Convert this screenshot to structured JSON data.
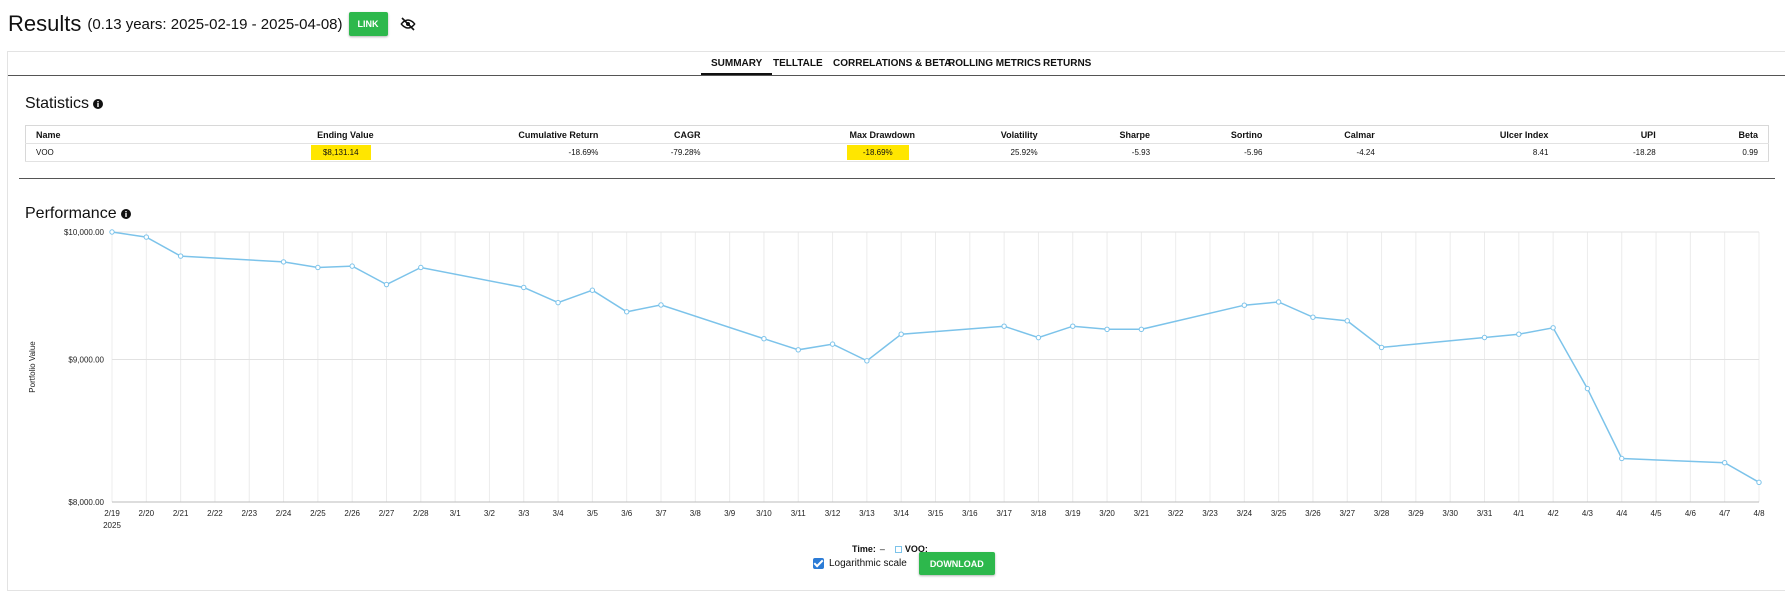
{
  "header": {
    "title": "Results",
    "range": "(0.13 years: 2025-02-19 - 2025-04-08)",
    "link_label": "LINK"
  },
  "tabs": [
    {
      "label": "SUMMARY",
      "active": true
    },
    {
      "label": "TELLTALE",
      "active": false
    },
    {
      "label": "CORRELATIONS & BETA",
      "active": false
    },
    {
      "label": "ROLLING METRICS",
      "active": false
    },
    {
      "label": "RETURNS",
      "active": false
    }
  ],
  "statistics": {
    "title": "Statistics",
    "columns": [
      "Name",
      "Ending Value",
      "Cumulative Return",
      "CAGR",
      "Max Drawdown",
      "Volatility",
      "Sharpe",
      "Sortino",
      "Calmar",
      "Ulcer Index",
      "UPI",
      "Beta"
    ],
    "rows": [
      [
        "VOO",
        "$8,131.14",
        "-18.69%",
        "-79.28%",
        "-18.69%",
        "25.92%",
        "-5.93",
        "-5.96",
        "-4.24",
        "8.41",
        "-18.28",
        "0.99"
      ]
    ],
    "highlight_color": "#ffe600"
  },
  "performance": {
    "title": "Performance"
  },
  "chart_data": {
    "type": "line",
    "ylabel": "Portfolio Value",
    "log_scale": true,
    "grid": true,
    "y_ticks": [
      "$10,000.00",
      "$9,000.00",
      "$8,000.00"
    ],
    "y_tick_values": [
      10000,
      9000,
      8000
    ],
    "x_year_label": "2025",
    "categories": [
      "2/19",
      "2/20",
      "2/21",
      "2/22",
      "2/23",
      "2/24",
      "2/25",
      "2/26",
      "2/27",
      "2/28",
      "3/1",
      "3/2",
      "3/3",
      "3/4",
      "3/5",
      "3/6",
      "3/7",
      "3/8",
      "3/9",
      "3/10",
      "3/11",
      "3/12",
      "3/13",
      "3/14",
      "3/15",
      "3/16",
      "3/17",
      "3/18",
      "3/19",
      "3/20",
      "3/21",
      "3/22",
      "3/23",
      "3/24",
      "3/25",
      "3/26",
      "3/27",
      "3/28",
      "3/29",
      "3/30",
      "3/31",
      "4/1",
      "4/2",
      "4/3",
      "4/4",
      "4/5",
      "4/6",
      "4/7",
      "4/8"
    ],
    "series": [
      {
        "name": "VOO",
        "color": "#7cc3ea",
        "points": [
          [
            "2/19",
            10000
          ],
          [
            "2/20",
            9958
          ],
          [
            "2/21",
            9803
          ],
          [
            "2/24",
            9756
          ],
          [
            "2/25",
            9711
          ],
          [
            "2/26",
            9722
          ],
          [
            "2/27",
            9575
          ],
          [
            "2/28",
            9711
          ],
          [
            "3/3",
            9552
          ],
          [
            "3/4",
            9433
          ],
          [
            "3/5",
            9530
          ],
          [
            "3/6",
            9362
          ],
          [
            "3/7",
            9415
          ],
          [
            "3/10",
            9156
          ],
          [
            "3/11",
            9072
          ],
          [
            "3/12",
            9115
          ],
          [
            "3/13",
            8990
          ],
          [
            "3/14",
            9190
          ],
          [
            "3/17",
            9251
          ],
          [
            "3/18",
            9164
          ],
          [
            "3/19",
            9251
          ],
          [
            "3/20",
            9227
          ],
          [
            "3/21",
            9227
          ],
          [
            "3/24",
            9413
          ],
          [
            "3/25",
            9438
          ],
          [
            "3/26",
            9320
          ],
          [
            "3/27",
            9292
          ],
          [
            "3/28",
            9090
          ],
          [
            "3/31",
            9165
          ],
          [
            "4/1",
            9190
          ],
          [
            "4/2",
            9239
          ],
          [
            "4/3",
            8786
          ],
          [
            "4/4",
            8293
          ],
          [
            "4/7",
            8264
          ],
          [
            "4/8",
            8131
          ]
        ]
      }
    ]
  },
  "legend": {
    "time_label": "Time:",
    "time_value": "–",
    "series_label": "VOO:"
  },
  "controls": {
    "log_label": "Logarithmic scale",
    "log_checked": true,
    "download_label": "DOWNLOAD"
  }
}
